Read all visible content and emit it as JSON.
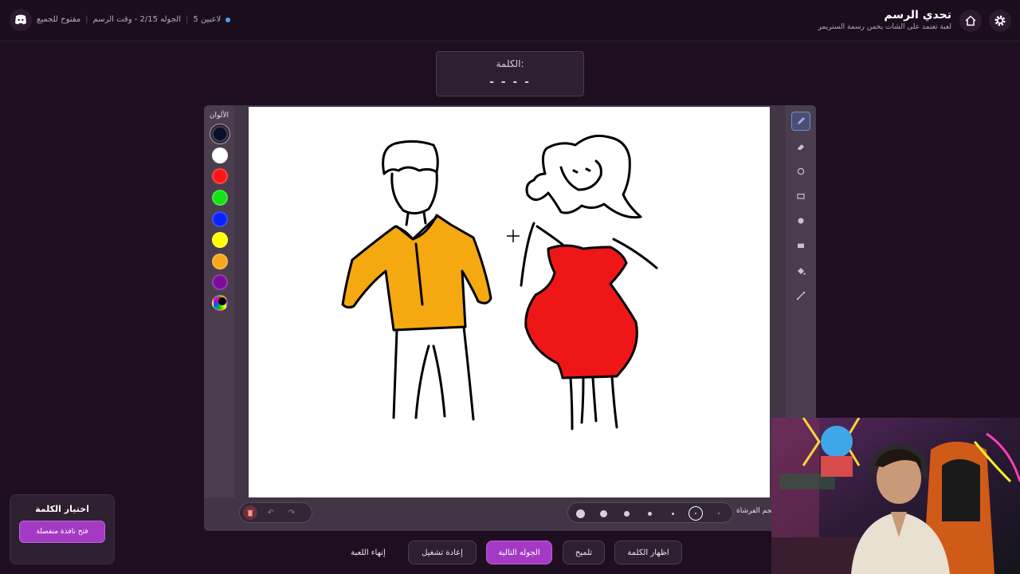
{
  "topbar": {
    "status": {
      "mode": "مفتوح للجميع",
      "round_time": "الجوله 2/15 - وقت الرسم",
      "players": "5 لاعبين"
    },
    "brand_title": "تحدي الرسم",
    "brand_subtitle": "لعبة تعتمد على الشات يخمن رسمة الستريمر"
  },
  "word": {
    "label": "الكلمة:",
    "hint": "- - - -"
  },
  "palette": {
    "header": "الألوان",
    "colors": [
      "#0b0f2a",
      "#ffffff",
      "#ff1414",
      "#16e016",
      "#0a22ff",
      "#ffff00",
      "#f6a81a",
      "#7d0c9a"
    ]
  },
  "tools": [
    "pencil-icon",
    "eraser-icon",
    "circle-outline-icon",
    "rect-outline-icon",
    "circle-fill-icon",
    "rect-fill-icon",
    "fill-bucket-icon",
    "line-icon"
  ],
  "brush": {
    "label": "حجم الفرشاة:"
  },
  "actions": {
    "end_game": "إنهاء اللعبة",
    "restart": "إعادة تشغيل",
    "next_round": "الجوله التالية",
    "hint": "تلميح",
    "show_word": "اظهار الكلمة"
  },
  "choose_panel": {
    "title": "اختيار الكلمة",
    "button": "فتح نافذة منفصلة"
  }
}
